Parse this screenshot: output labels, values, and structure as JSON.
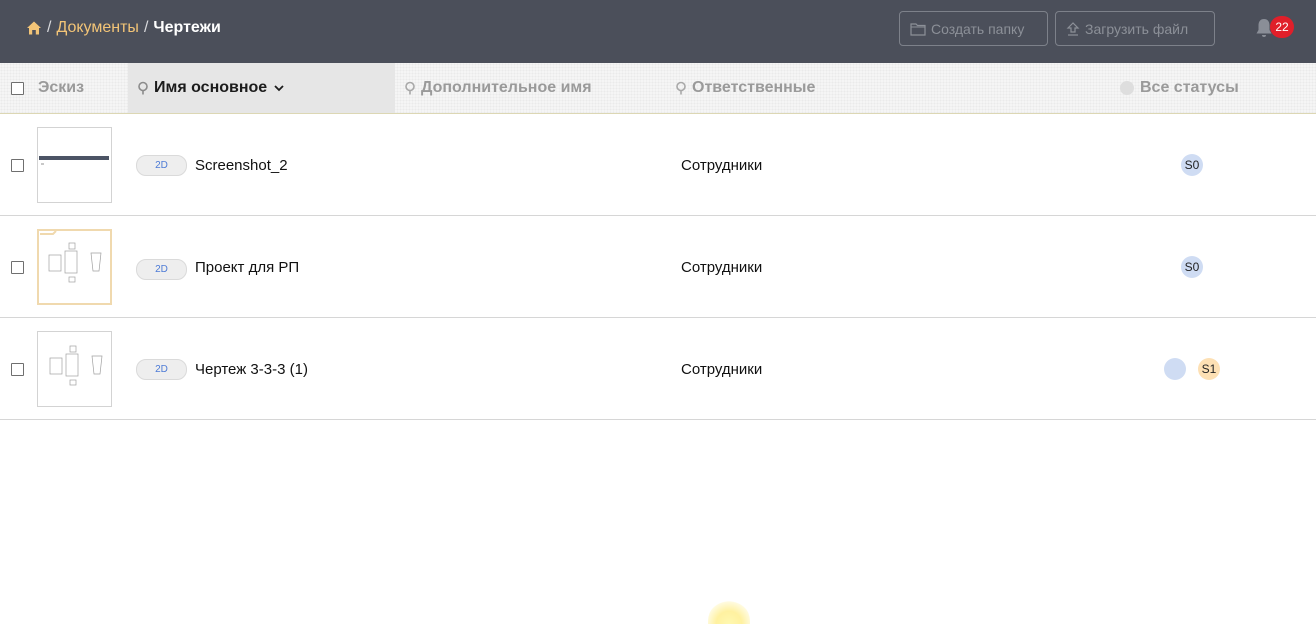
{
  "breadcrumb": {
    "home_icon": "home-icon",
    "separator": "/",
    "items": [
      "Документы"
    ],
    "current": "Чертежи"
  },
  "toolbar": {
    "create_folder_label": "Создать папку",
    "upload_file_label": "Загрузить файл",
    "notifications_count": "22"
  },
  "table": {
    "columns": {
      "sketch": "Эскиз",
      "primary_name": "Имя основное",
      "secondary_name": "Дополнительное имя",
      "responsible": "Ответственные",
      "statuses": "Все статусы"
    },
    "rows": [
      {
        "type_tag": "2D",
        "name": "Screenshot_2",
        "responsible": "Сотрудники",
        "statuses": [
          "S0"
        ]
      },
      {
        "type_tag": "2D",
        "name": "Проект для РП",
        "responsible": "Сотрудники",
        "statuses": [
          "S0"
        ]
      },
      {
        "type_tag": "2D",
        "name": "Чертеж 3-3-3 (1)",
        "responsible": "Сотрудники",
        "statuses": [
          "",
          "S1"
        ]
      }
    ]
  },
  "colors": {
    "topbar": "#4b4f5a",
    "breadcrumb_link": "#f2c477",
    "badge": "#e01f2a",
    "status_s0": "#cfdcf3",
    "status_s1": "#fde0b4",
    "tag_text": "#4d7bd6"
  }
}
